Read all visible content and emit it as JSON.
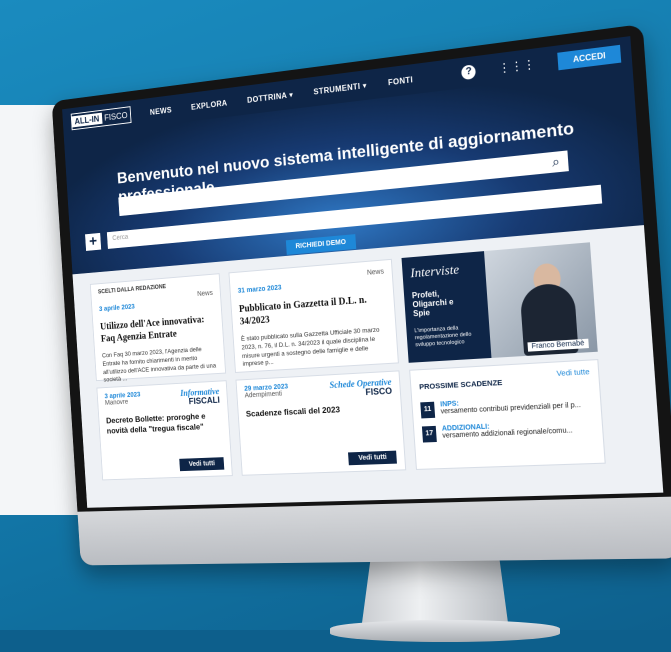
{
  "nav": {
    "logo_a": "ALL-IN",
    "logo_b": "FISCO",
    "items": [
      "NEWS",
      "EXPLORA",
      "DOTTRINA ▾",
      "STRUMENTI ▾",
      "FONTI"
    ],
    "help": "?",
    "login_label": "ACCEDI"
  },
  "hero": {
    "title": "Benvenuto nel nuovo sistema intelligente di aggiornamento professionale",
    "search_placeholder": "Cerca",
    "demo_button": "RICHIEDI DEMO"
  },
  "cards": {
    "card1": {
      "section": "SCELTI DALLA REDAZIONE",
      "date": "3 aprile 2023",
      "category": "News",
      "headline": "Utilizzo dell'Ace innovativa: Faq Agenzia Entrate",
      "body": "Con Faq 30 marzo 2023, l'Agenzia delle Entrate ha fornito chiarimenti in merito all'utilizzo dell'ACE innovativa da parte di una società ..."
    },
    "card2": {
      "date": "31 marzo 2023",
      "category": "News",
      "headline": "Pubblicato in Gazzetta il D.L. n. 34/2023",
      "body": "È stato pubblicato sulla Gazzetta Ufficiale 30 marzo 2023, n. 76, il D.L. n. 34/2023 il quale disciplina le misure urgenti a sostegno delle famiglie e delle imprese p..."
    },
    "card3": {
      "date": "3 aprile 2023",
      "category": "Manovre",
      "brand_a": "Informative",
      "brand_b": "FISCALI",
      "headline": "Decreto Bollette: proroghe e novità della \"tregua fiscale\"",
      "button": "Vedi tutti"
    },
    "card4": {
      "date": "29 marzo 2023",
      "category": "Adempimenti",
      "brand_a": "Schede Operative",
      "brand_b": "FISCO",
      "headline": "Scadenze fiscali del 2023",
      "button": "Vedi tutti"
    }
  },
  "interviste": {
    "title": "Interviste",
    "subtitle": "Profeti, Oligarchi e Spie",
    "caption": "L'importanza della regolamentazione dello sviluppo tecnologico",
    "person": "Franco Bernabè"
  },
  "scadenze": {
    "title": "PROSSIME SCADENZE",
    "link": "Vedi tutte",
    "items": [
      {
        "day": "11",
        "type": "INPS:",
        "desc": "versamento contributi previdenziali per il p..."
      },
      {
        "day": "17",
        "type": "ADDIZIONALI:",
        "desc": "versamento addizionali regionale/comu..."
      }
    ]
  }
}
